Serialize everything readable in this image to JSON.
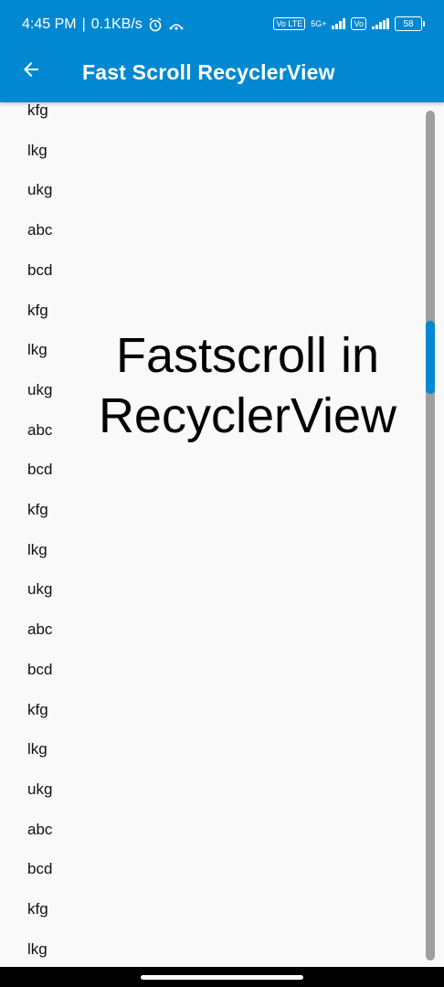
{
  "status_bar": {
    "time": "4:45 PM",
    "data_speed": "0.1KB/s",
    "network": "5G+",
    "volte": "Vo LTE",
    "battery": "58"
  },
  "app_bar": {
    "title": "Fast Scroll RecyclerView"
  },
  "list": {
    "items": [
      "kfg",
      "lkg",
      "ukg",
      "abc",
      "bcd",
      "kfg",
      "lkg",
      "ukg",
      "abc",
      "bcd",
      "kfg",
      "lkg",
      "ukg",
      "abc",
      "bcd",
      "kfg",
      "lkg",
      "ukg",
      "abc",
      "bcd",
      "kfg",
      "lkg"
    ]
  },
  "overlay": {
    "line1": "Fastscroll in",
    "line2": "RecyclerView"
  },
  "colors": {
    "primary": "#0288d1",
    "scroll_track": "#9e9e9e"
  },
  "scroll": {
    "position_fraction": 0.27
  }
}
